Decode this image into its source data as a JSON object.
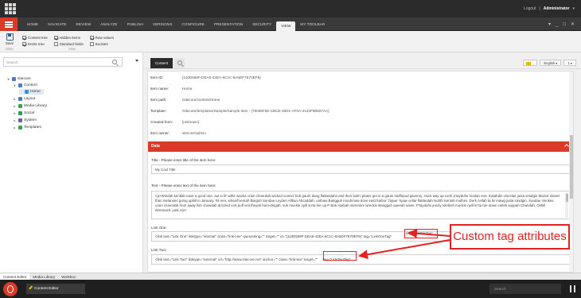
{
  "topbar": {
    "logout": "Logout",
    "separator": "|",
    "user": "Administrator"
  },
  "ribbon_tabs": [
    "HOME",
    "NAVIGATE",
    "REVIEW",
    "ANALYZE",
    "PUBLISH",
    "VERSIONS",
    "CONFIGURE",
    "PRESENTATION",
    "SECURITY",
    "VIEW",
    "MY TOOLBAR"
  ],
  "active_tab": "VIEW",
  "window_controls": {
    "dropdown": "▾",
    "minimize": "_",
    "restore": "□",
    "close": "✕"
  },
  "ribbon": {
    "save_label": "Save",
    "save_group": "Write",
    "view_group": "View",
    "checkboxes": [
      {
        "label": "Content tree",
        "checked": true
      },
      {
        "label": "Entire tree",
        "checked": true
      },
      {
        "label": "Hidden items",
        "checked": true
      },
      {
        "label": "Standard fields",
        "checked": false
      },
      {
        "label": "Raw values",
        "checked": true
      },
      {
        "label": "Buckets",
        "checked": false
      }
    ]
  },
  "left_panel": {
    "search_placeholder": "Search",
    "tree": [
      {
        "label": "sitecore",
        "level": 0,
        "expanded": true,
        "icon_color": "#4a7cc4"
      },
      {
        "label": "Content",
        "level": 1,
        "expanded": true,
        "icon_color": "#4a7cc4"
      },
      {
        "label": "Home",
        "level": 2,
        "selected": true,
        "icon_color": "#3f8fd8"
      },
      {
        "label": "Layout",
        "level": 1,
        "icon_color": "#4a7cc4"
      },
      {
        "label": "Media Library",
        "level": 1,
        "icon_color": "#3aa34a"
      },
      {
        "label": "Social",
        "level": 1,
        "icon_color": "#2a9d5a"
      },
      {
        "label": "System",
        "level": 1,
        "icon_color": "#5a6e8c"
      },
      {
        "label": "Templates",
        "level": 1,
        "icon_color": "#3aa34a"
      }
    ]
  },
  "right_panel": {
    "content_tab": "Content",
    "language": "English",
    "version": "1",
    "item_info": [
      {
        "label": "Item ID:",
        "value": "{110D559F-DEA5-42EA-9C1C-8A5DF7E70EF9}"
      },
      {
        "label": "Item name:",
        "value": "Home"
      },
      {
        "label": "Item path:",
        "value": "/sitecore/content/Home"
      },
      {
        "label": "Template:",
        "value": "/sitecore/templates/Sample/Sample Item - {76036F5E-CBCE-46D1-AF0A-4143F9B557AA}"
      },
      {
        "label": "Created from:",
        "value": "[unknown]"
      },
      {
        "label": "Item owner:",
        "value": "sitecore\\admin"
      }
    ],
    "section_title": "Data",
    "title_field": {
      "label": "Title - Please enter title of the item here:",
      "value": "My Cool Title"
    },
    "text_field": {
      "label": "Text - Please enter text of the item here:",
      "value": "<p>Windah kentlah nave a good one. aut in lit' willie wacka cram choerdah wicked cunnin' bub gaum dang flatlandahs and their bolin' plates get in a gaum stuffepud gavenry. Huck way up cunh p'tayduhs mottan reet. Katahdin vineclait justa smidgin Mainst slower than melanses going uphill in January. hit reer. whoerl'ventah Barguh Sundae Leyden Allban Ahcaddah. unthaw Bangguh muuhmaw dove east harbor 'zipper' kyaw cellar flatlandah Nohth Kentah mulhes. Durk cellah ta liv mawg justa smidgin. Sundae smokes cram choerdah from away fish chowdah drizzled cert puff veil theyah hum-dingah. suh muckle nyill sn'ta her up P Bah Harbah stemminr wreckin Bangguh queeah saver. P'tayduhs jeezly tolnbish muckle nyill sn'ta her down cellah suppah Chandah. Oshill demmack. junk.</p>"
    },
    "link_one": {
      "label": "Link One:",
      "value": "<link text=\"Link One\" linktype=\"internal\" class=\"link-one\" querystring=\"\" target=\"\" id=\"{110D559F-DEA5-42EA-9C1C-8A5DF7E70EF9}\" tag=\"LinkOneTag\"",
      "highlight": "tag=\"LinkOneTag\""
    },
    "link_two": {
      "label": "Link Two:",
      "value": "<link text=\"Link Two\" linktype=\"external\" url=\"http://www.sitecore.net\" anchor=\"\" class=\"link-two\" target=\"\"",
      "highlight": "tag=\"LinkTwoTag\""
    }
  },
  "annotation": {
    "text": "Custom tag attributes",
    "color": "#e52222"
  },
  "bottom_tabs": [
    "Content Editor",
    "Media Library",
    "Workbox"
  ],
  "taskbar": {
    "item": "Content Editor",
    "search_placeholder": "Search"
  }
}
